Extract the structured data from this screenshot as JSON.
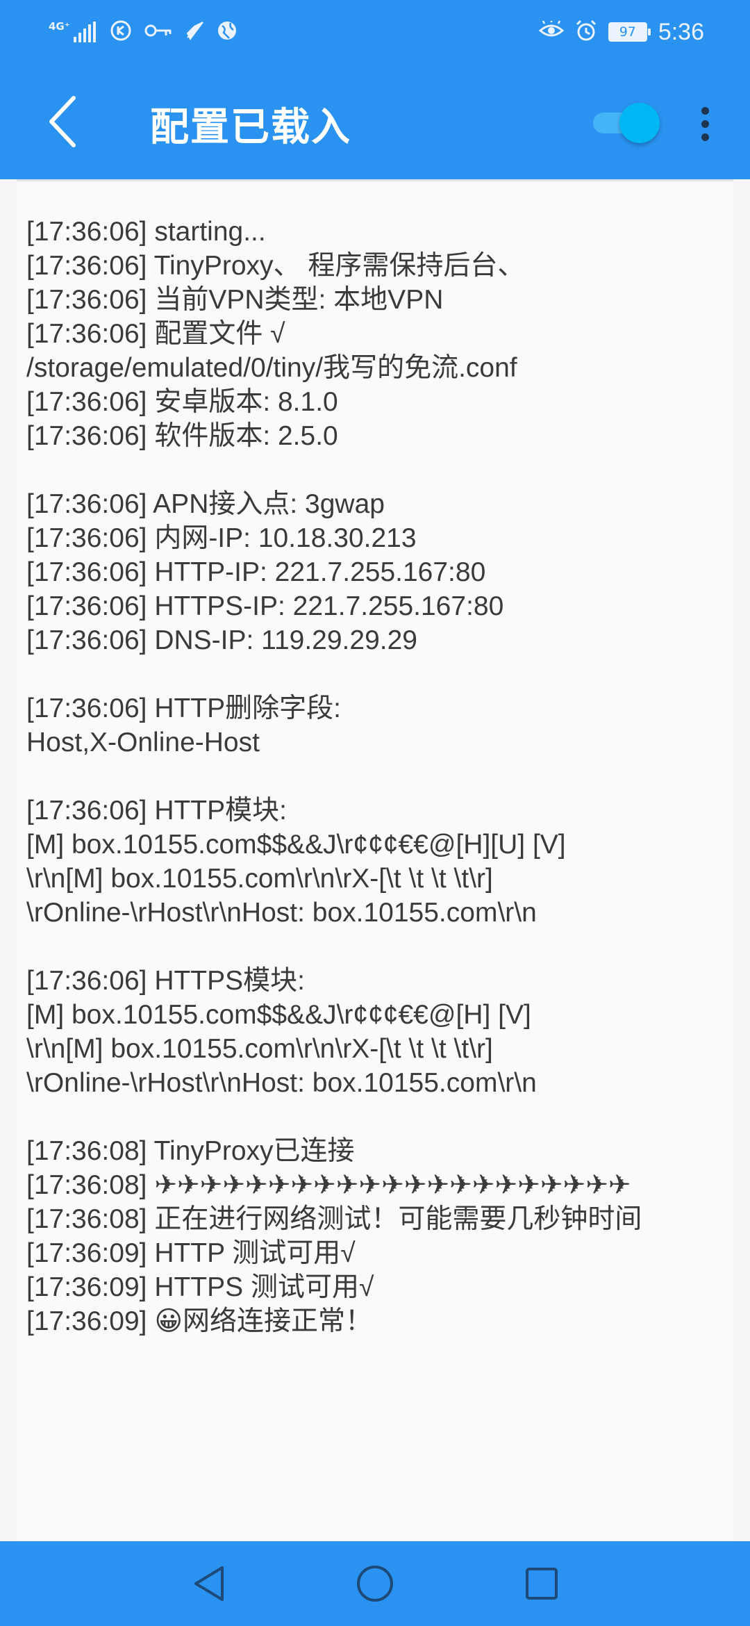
{
  "status_bar": {
    "network_label": "4G⁺",
    "time": "5:36",
    "battery_level": "97"
  },
  "app_bar": {
    "title": "配置已载入",
    "vpn_toggle_on": true
  },
  "log_lines": [
    "[17:36:06] starting...",
    "[17:36:06] TinyProxy、 程序需保持后台、",
    "[17:36:06] 当前VPN类型: 本地VPN",
    "[17:36:06] 配置文件 √",
    "/storage/emulated/0/tiny/我写的免流.conf",
    "[17:36:06] 安卓版本: 8.1.0",
    "[17:36:06] 软件版本: 2.5.0",
    "",
    "[17:36:06] APN接入点: 3gwap",
    "[17:36:06] 内网-IP: 10.18.30.213",
    "[17:36:06] HTTP-IP: 221.7.255.167:80",
    "[17:36:06] HTTPS-IP: 221.7.255.167:80",
    "[17:36:06] DNS-IP: 119.29.29.29",
    "",
    "[17:36:06] HTTP删除字段:",
    "Host,X-Online-Host",
    "",
    "[17:36:06] HTTP模块:",
    "[M] box.10155.com$$&&J\\r¢¢¢€€@[H][U] [V]",
    "\\r\\n[M] box.10155.com\\r\\n\\rX-[\\t \\t \\t \\t\\r]",
    "\\rOnline-\\rHost\\r\\nHost: box.10155.com\\r\\n",
    "",
    "[17:36:06] HTTPS模块:",
    "[M] box.10155.com$$&&J\\r¢¢¢€€@[H] [V]",
    "\\r\\n[M] box.10155.com\\r\\n\\rX-[\\t \\t \\t \\t\\r]",
    "\\rOnline-\\rHost\\r\\nHost: box.10155.com\\r\\n",
    "",
    "[17:36:08] TinyProxy已连接",
    "[17:36:08] ✈✈✈✈✈✈✈✈✈✈✈✈✈✈✈✈✈✈✈✈✈",
    "[17:36:08] 正在进行网络测试！可能需要几秒钟时间",
    "[17:36:09] HTTP 测试可用√",
    "[17:36:09] HTTPS 测试可用√",
    "[17:36:09] 😀网络连接正常！"
  ],
  "colors": {
    "accent": "#2a92f0",
    "toggle_thumb": "#00b7f3",
    "log_text": "#3a3a3a",
    "background": "#fafafa"
  },
  "icons": {
    "status_left": [
      "signal-icon",
      "data-saver-icon",
      "vpn-key-icon",
      "rocket-icon",
      "globe-icon"
    ],
    "status_right": [
      "eye-comfort-icon",
      "alarm-icon",
      "battery-icon"
    ],
    "nav": [
      "back-triangle-icon",
      "home-circle-icon",
      "recents-square-icon"
    ]
  }
}
